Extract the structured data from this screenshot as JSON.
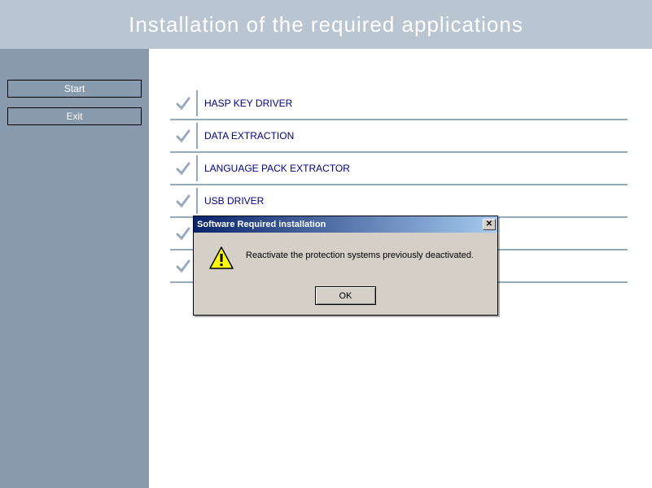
{
  "header": {
    "title": "Installation of the required applications"
  },
  "sidebar": {
    "start_label": "Start",
    "exit_label": "Exit"
  },
  "items": [
    {
      "label": "HASP KEY DRIVER",
      "checked": true
    },
    {
      "label": "DATA EXTRACTION",
      "checked": true
    },
    {
      "label": "LANGUAGE PACK EXTRACTOR",
      "checked": true
    },
    {
      "label": "USB DRIVER",
      "checked": true
    },
    {
      "label": "",
      "checked": true
    },
    {
      "label": "",
      "checked": true
    }
  ],
  "modal": {
    "title": "Software Required installation",
    "message": "Reactivate the protection systems previously deactivated.",
    "ok_label": "OK",
    "close_symbol": "✕"
  }
}
